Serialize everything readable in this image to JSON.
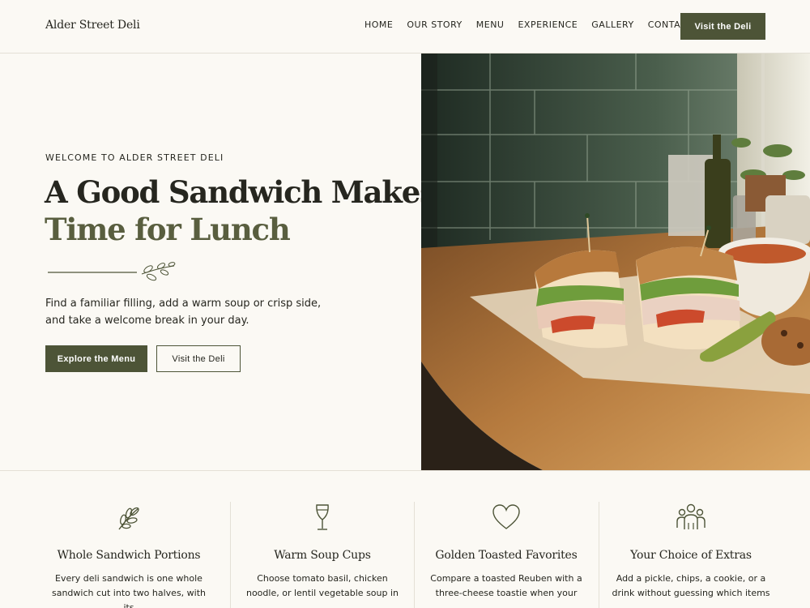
{
  "header": {
    "brand": "Alder Street Deli",
    "nav": [
      "HOME",
      "OUR STORY",
      "MENU",
      "EXPERIENCE",
      "GALLERY",
      "CONTACT"
    ],
    "cta_label": "Visit the Deli"
  },
  "hero": {
    "eyebrow": "WELCOME TO ALDER STREET DELI",
    "headline_line1": "A Good Sandwich Makes",
    "headline_line2": "Time for Lunch",
    "lead": "Find a familiar filling, add a warm soup or crisp side, and take a welcome break in your day.",
    "primary_cta": "Explore the Menu",
    "secondary_cta": "Visit the Deli",
    "image_subject": "halved toasted turkey sandwich with pickle, soup bowl and cookie on wooden counter"
  },
  "features": [
    {
      "icon": "sprig-icon",
      "title": "Whole Sandwich Portions",
      "text": "Every deli sandwich is one whole sandwich cut into two halves, with its"
    },
    {
      "icon": "wine-glass-icon",
      "title": "Warm Soup Cups",
      "text": "Choose tomato basil, chicken noodle, or lentil vegetable soup in"
    },
    {
      "icon": "heart-icon",
      "title": "Golden Toasted Favorites",
      "text": "Compare a toasted Reuben with a three-cheese toastie when your"
    },
    {
      "icon": "people-icon",
      "title": "Your Choice of Extras",
      "text": "Add a pickle, chips, a cookie, or a drink without guessing which items"
    }
  ],
  "colors": {
    "background": "#fbf9f4",
    "accent_green": "#4d5437",
    "headline_accent": "#595e3f",
    "text": "#26261f",
    "rule": "#e4e0d6"
  }
}
